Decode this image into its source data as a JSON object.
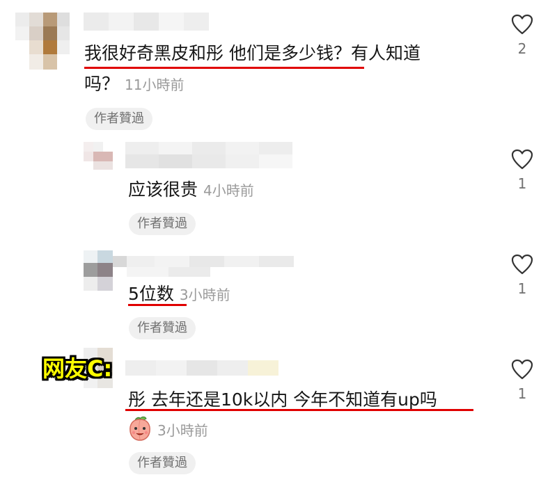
{
  "comments": [
    {
      "text_line1": "我很好奇黑皮和彤 他们是多少钱？有人知道",
      "text_line2": "吗？",
      "time": "11小時前",
      "badge": "作者贊過",
      "likes": "2"
    },
    {
      "text": "应该很贵",
      "time": "4小時前",
      "badge": "作者贊過",
      "likes": "1"
    },
    {
      "text": "5位数",
      "time": "3小時前",
      "badge": "作者贊過",
      "likes": "1"
    },
    {
      "label": "网友C:",
      "text": "彤 去年还是10k以内 今年不知道有up吗",
      "time": "3小時前",
      "badge": "作者贊過",
      "likes": "1"
    }
  ],
  "icons": {
    "like": "heart-outline-icon",
    "emoji": "peach-face-icon"
  },
  "colors": {
    "underline": "#e00000",
    "label": "#ffff00",
    "meta": "#9a9a9a"
  }
}
